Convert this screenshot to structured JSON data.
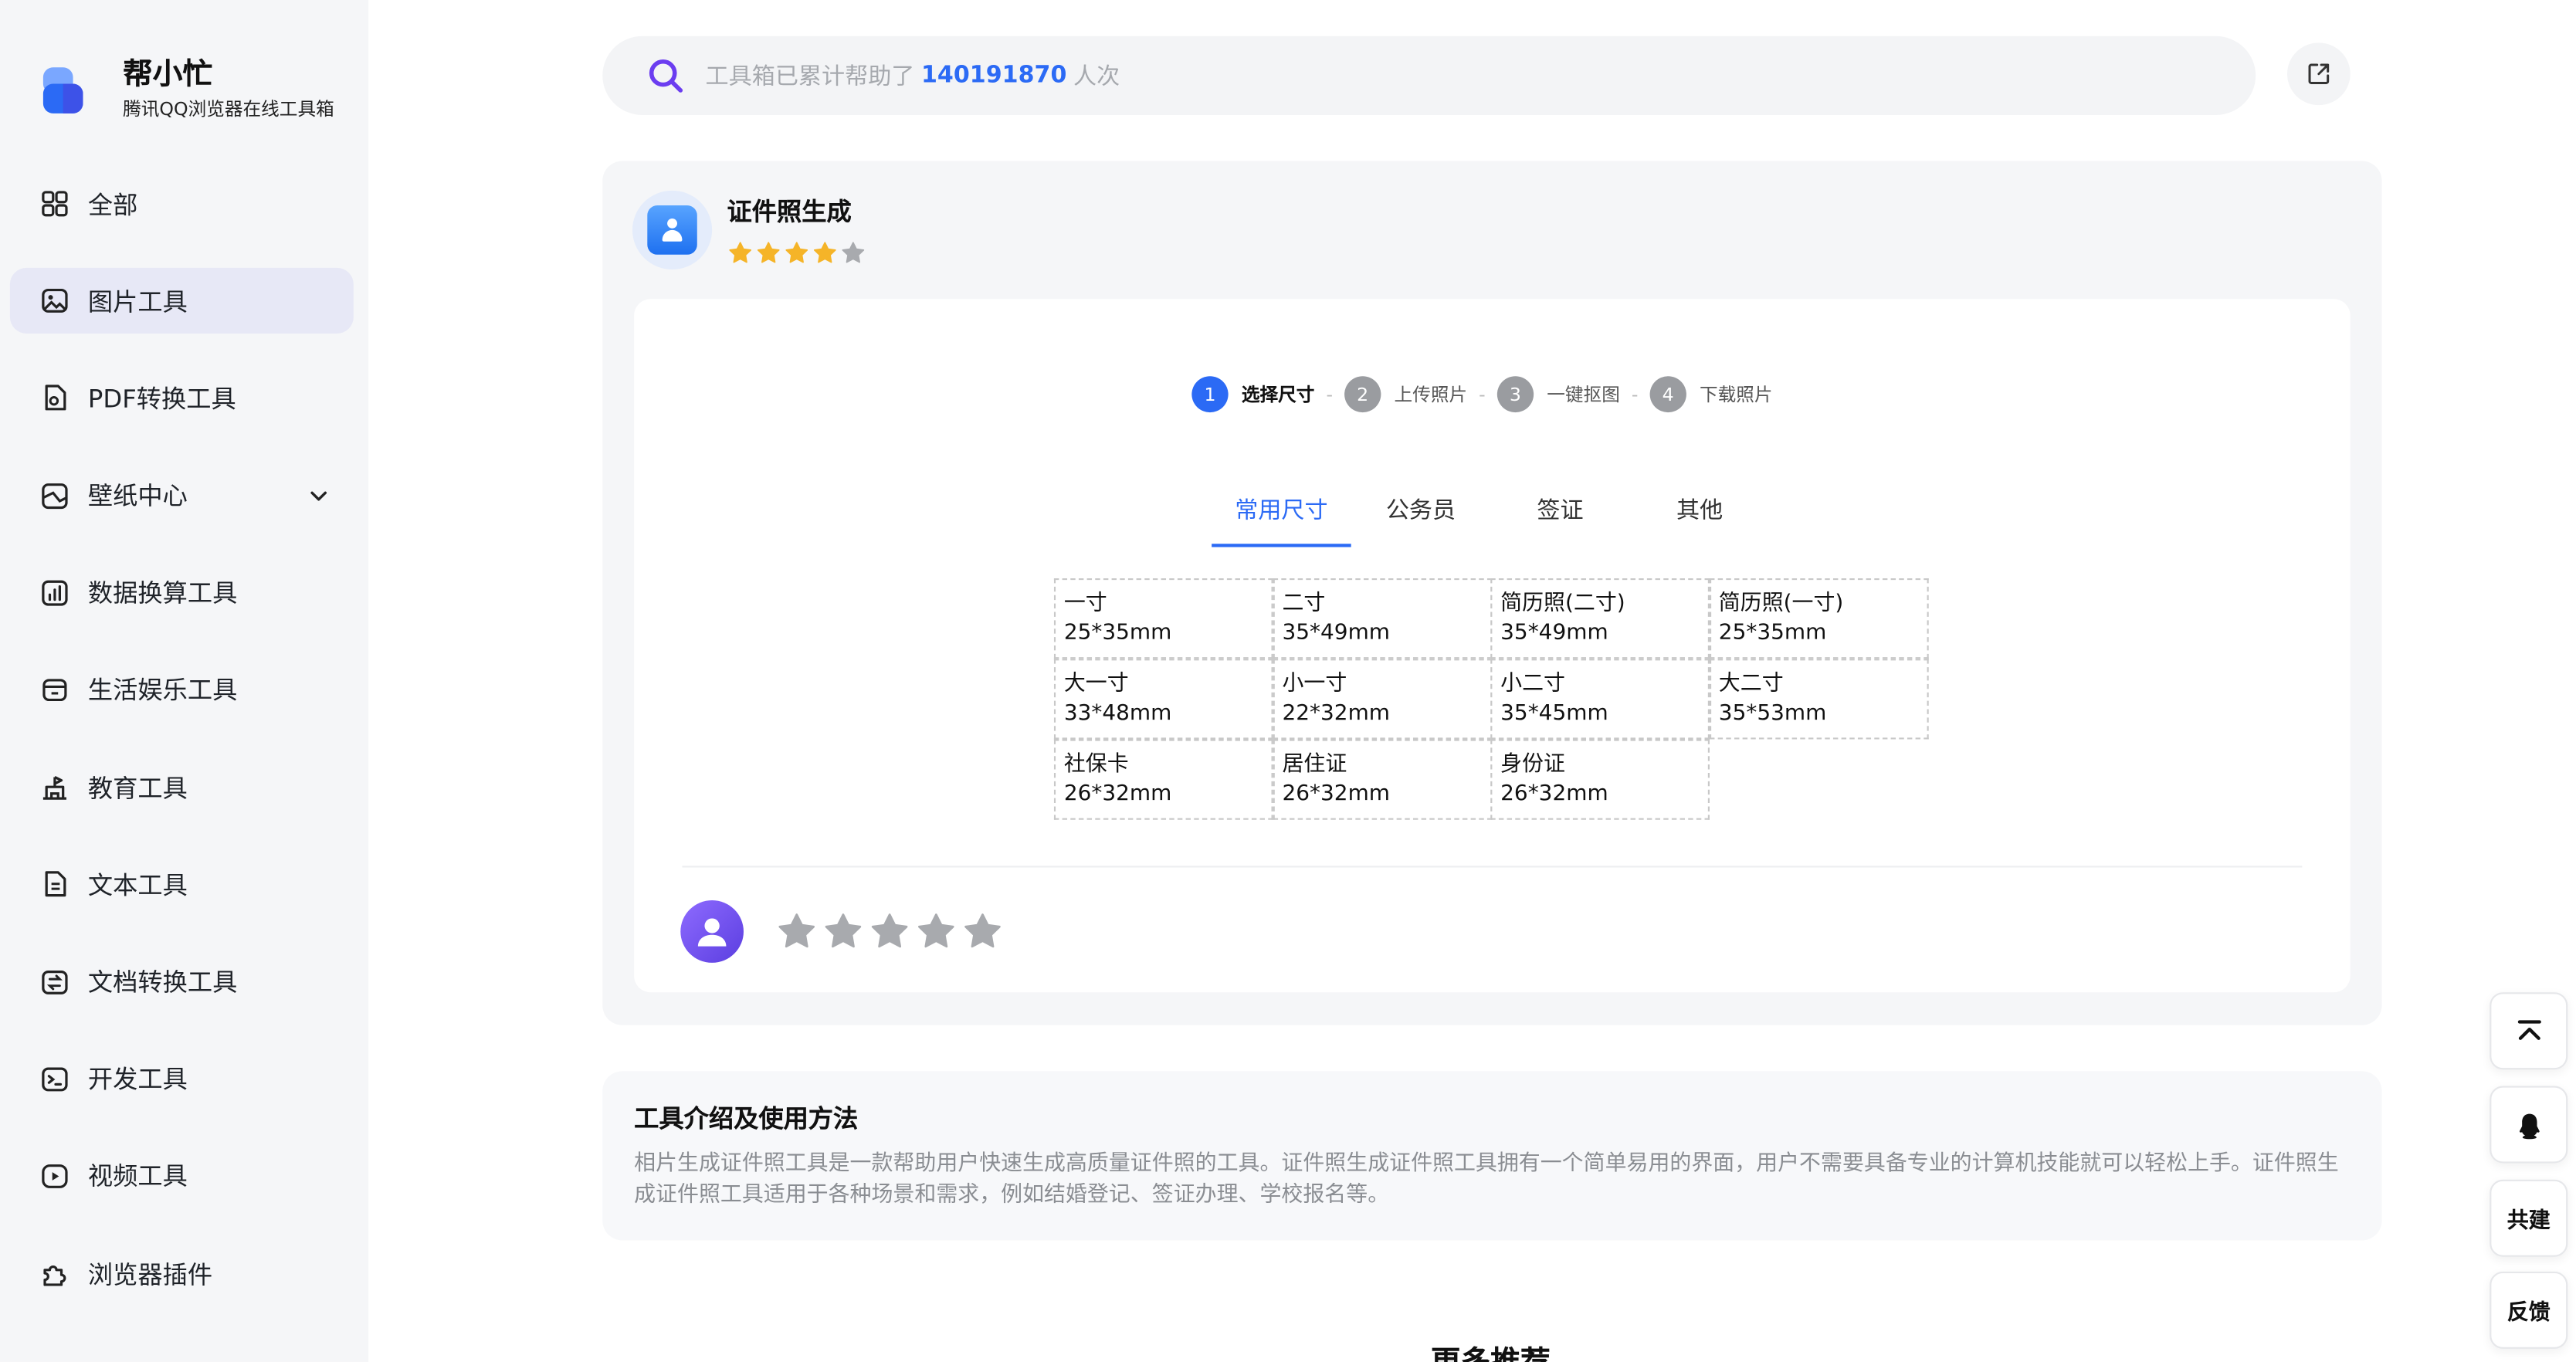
{
  "brand": {
    "title": "帮小忙",
    "subtitle": "腾讯QQ浏览器在线工具箱"
  },
  "sidebar": {
    "items": [
      {
        "label": "全部",
        "icon": "grid-icon"
      },
      {
        "label": "图片工具",
        "icon": "image-icon",
        "active": true
      },
      {
        "label": "PDF转换工具",
        "icon": "pdf-icon"
      },
      {
        "label": "壁纸中心",
        "icon": "wallpaper-icon",
        "expandable": true
      },
      {
        "label": "数据换算工具",
        "icon": "chart-icon"
      },
      {
        "label": "生活娱乐工具",
        "icon": "store-icon"
      },
      {
        "label": "教育工具",
        "icon": "school-icon"
      },
      {
        "label": "文本工具",
        "icon": "document-icon"
      },
      {
        "label": "文档转换工具",
        "icon": "convert-icon"
      },
      {
        "label": "开发工具",
        "icon": "terminal-icon"
      },
      {
        "label": "视频工具",
        "icon": "play-icon"
      },
      {
        "label": "浏览器插件",
        "icon": "puzzle-icon"
      }
    ]
  },
  "search": {
    "prefix": "工具箱已累计帮助了",
    "count": "140191870",
    "suffix": "人次"
  },
  "tool": {
    "title": "证件照生成",
    "rating": 4,
    "steps": [
      {
        "num": "1",
        "label": "选择尺寸"
      },
      {
        "num": "2",
        "label": "上传照片"
      },
      {
        "num": "3",
        "label": "一键抠图"
      },
      {
        "num": "4",
        "label": "下载照片"
      }
    ],
    "tabs": [
      "常用尺寸",
      "公务员",
      "签证",
      "其他"
    ],
    "sizes": [
      {
        "name": "一寸",
        "dim": "25*35mm"
      },
      {
        "name": "二寸",
        "dim": "35*49mm"
      },
      {
        "name": "简历照(二寸)",
        "dim": "35*49mm"
      },
      {
        "name": "简历照(一寸)",
        "dim": "25*35mm"
      },
      {
        "name": "大一寸",
        "dim": "33*48mm"
      },
      {
        "name": "小一寸",
        "dim": "22*32mm"
      },
      {
        "name": "小二寸",
        "dim": "35*45mm"
      },
      {
        "name": "大二寸",
        "dim": "35*53mm"
      },
      {
        "name": "社保卡",
        "dim": "26*32mm"
      },
      {
        "name": "居住证",
        "dim": "26*32mm"
      },
      {
        "name": "身份证",
        "dim": "26*32mm"
      }
    ]
  },
  "intro": {
    "title": "工具介绍及使用方法",
    "text": "相片生成证件照工具是一款帮助用户快速生成高质量证件照的工具。证件照生成证件照工具拥有一个简单易用的界面，用户不需要具备专业的计算机技能就可以轻松上手。证件照生成证件照工具适用于各种场景和需求，例如结婚登记、签证办理、学校报名等。"
  },
  "more_title": "更多推荐",
  "float": {
    "cobuild": "共建",
    "feedback": "反馈"
  },
  "colors": {
    "accent": "#2b6af5",
    "star": "#f5b428",
    "star_empty": "#a8aaae"
  }
}
